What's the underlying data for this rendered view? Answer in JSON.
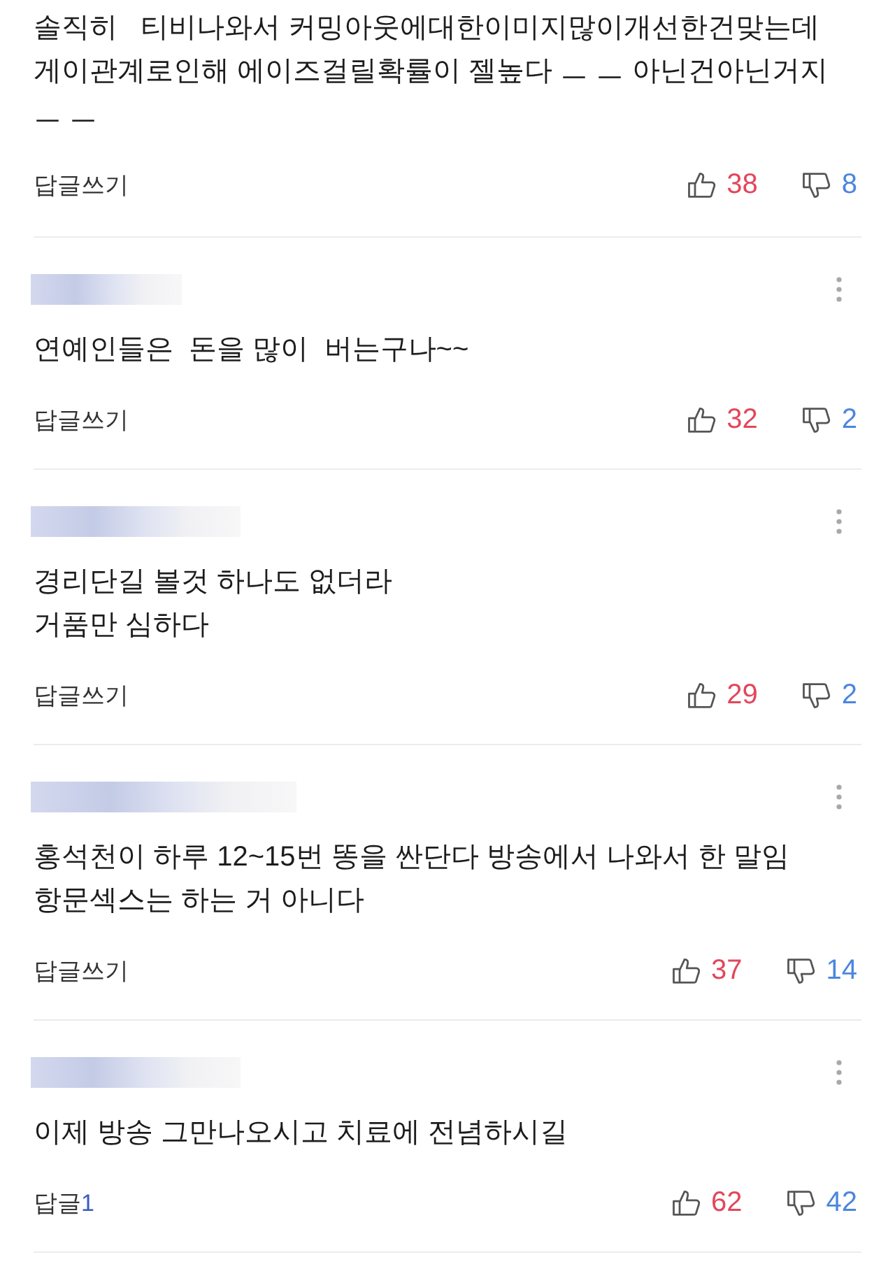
{
  "comments": [
    {
      "kind": "partial",
      "text": "솔직히   티비나와서 커밍아웃에대한이미지많이개선한건맞는데 게이관계로인해 에이즈걸릴확률이 젤높다 ㅡ ㅡ 아닌건아닌거지 ㅡ ㅡ",
      "reply": {
        "label": "답글쓰기"
      },
      "likes": "38",
      "dislikes": "8"
    },
    {
      "kind": "full",
      "text": "연예인들은  돈을 많이  버는구나~~",
      "reply": {
        "label": "답글쓰기"
      },
      "likes": "32",
      "dislikes": "2"
    },
    {
      "kind": "full",
      "text": "경리단길 볼것 하나도 없더라\n거품만 심하다",
      "reply": {
        "label": "답글쓰기"
      },
      "likes": "29",
      "dislikes": "2"
    },
    {
      "kind": "full",
      "text": "홍석천이 하루 12~15번 똥을 싼단다 방송에서 나와서 한 말임\n항문섹스는 하는 거 아니다",
      "reply": {
        "label": "답글쓰기"
      },
      "likes": "37",
      "dislikes": "14"
    },
    {
      "kind": "full",
      "text": "이제 방송 그만나오시고 치료에 전념하시길",
      "reply": {
        "label": "답글",
        "count": "1"
      },
      "likes": "62",
      "dislikes": "42"
    }
  ]
}
